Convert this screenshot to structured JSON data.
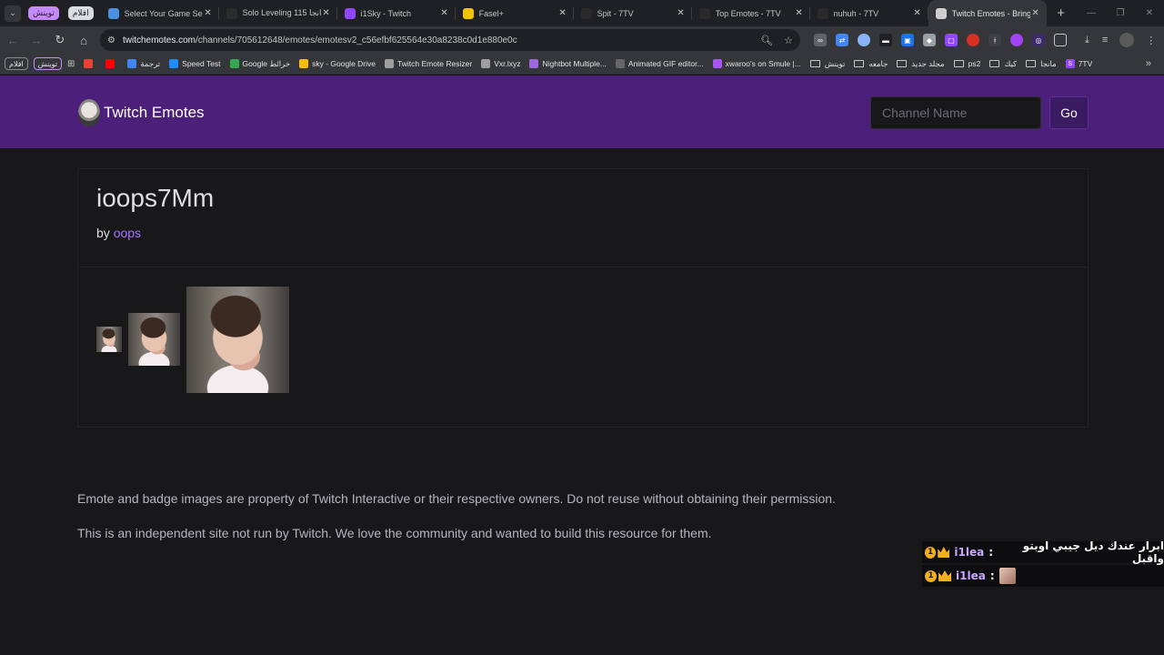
{
  "browser": {
    "tab_groups": {
      "group_a": "توينش",
      "group_b": "افلام"
    },
    "tabs": [
      {
        "title": "Select Your Game Serve",
        "icon": "game-server-icon",
        "color": "#4a90e2"
      },
      {
        "title": "Solo Leveling 115 مانجا",
        "icon": "manga-site-icon",
        "color": "#2c2c2c"
      },
      {
        "title": "i1Sky - Twitch",
        "icon": "twitch-icon",
        "color": "#9146ff"
      },
      {
        "title": "Fasel+",
        "icon": "fasel-icon",
        "color": "#f2c200"
      },
      {
        "title": "Spit - 7TV",
        "icon": "7tv-icon",
        "color": "#2a2a2a"
      },
      {
        "title": "Top Emotes - 7TV",
        "icon": "7tv-icon",
        "color": "#2a2a2a"
      },
      {
        "title": "nuhuh - 7TV",
        "icon": "7tv-icon",
        "color": "#2a2a2a"
      },
      {
        "title": "Twitch Emotes - Bringi",
        "icon": "twitchemotes-icon",
        "color": "#cfcfcf",
        "active": true
      }
    ],
    "address_bar": {
      "host": "twitchemotes.com",
      "path": "/channels/705612648/emotes/emotesv2_c56efbf625564e30a8238c0d1e880e0c"
    },
    "bookmarks": [
      {
        "label": "",
        "icon": "gmail-icon",
        "color": "#ea4335"
      },
      {
        "label": "",
        "icon": "youtube-icon",
        "color": "#ff0000"
      },
      {
        "label": "ترجمة",
        "icon": "translate-icon",
        "color": "#4285f4"
      },
      {
        "label": "Speed Test",
        "icon": "speedtest-icon",
        "color": "#1f8cff"
      },
      {
        "label": "Google خرائط",
        "icon": "maps-icon",
        "color": "#34a853"
      },
      {
        "label": "sky - Google Drive",
        "icon": "drive-icon",
        "color": "#fbbc04"
      },
      {
        "label": "Twitch Emote Resizer",
        "icon": "resizer-icon",
        "color": "#9e9e9e"
      },
      {
        "label": "Vxr.lxyz",
        "icon": "vxr-icon",
        "color": "#9e9e9e"
      },
      {
        "label": "Nightbot Multiple...",
        "icon": "nightbot-icon",
        "color": "#9c6ade"
      },
      {
        "label": "Animated GIF editor...",
        "icon": "gif-editor-icon",
        "color": "#666666"
      },
      {
        "label": "xwaroo's on Smule |...",
        "icon": "smule-icon",
        "color": "#a855f7"
      }
    ],
    "bookmark_folders": [
      "توينش",
      "جامعه",
      "مجلد جديد",
      "ps2",
      "كيك",
      "مانجا"
    ],
    "bookmark_7tv": "7TV"
  },
  "site": {
    "brand": "Twitch Emotes",
    "channel_placeholder": "Channel Name",
    "go_label": "Go"
  },
  "emote": {
    "name": "ioops7Mm",
    "by_prefix": "by",
    "author": "oops"
  },
  "footer": {
    "line1": "Emote and badge images are property of Twitch Interactive or their respective owners. Do not reuse without obtaining their permission.",
    "line2": "This is an independent site not run by Twitch. We love the community and wanted to build this resource for them."
  },
  "chat": [
    {
      "user": "i1lea",
      "separator": ":",
      "message": "ابرار عندك ديل جيبي اوبتو واقبل"
    },
    {
      "user": "i1lea",
      "separator": ":",
      "message": ""
    }
  ],
  "colors": {
    "header": "#4b1f7a",
    "accent_link": "#a970ff",
    "page_bg": "#18181b"
  }
}
